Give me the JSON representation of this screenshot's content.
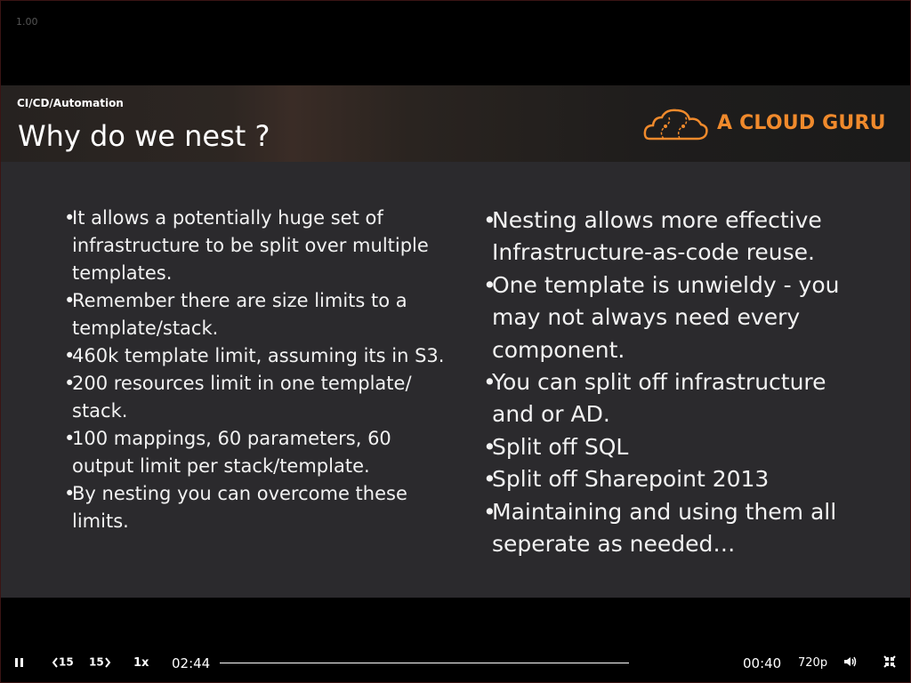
{
  "player": {
    "zoom_label": "1.00",
    "speed": "1x",
    "rewind_label": "15",
    "forward_label": "15",
    "current_time": "02:44",
    "remaining_time": "00:40",
    "quality": "720p",
    "icons": [
      "pause-icon",
      "rewind-15-icon",
      "forward-15-icon",
      "volume-icon",
      "exit-fullscreen-icon"
    ]
  },
  "slide": {
    "category": "CI/CD/Automation",
    "title": "Why do we nest ?",
    "logo_text": "A CLOUD GURU",
    "brand_color": "#f08a2c",
    "left_bullets": [
      "It allows a potentially huge set of infrastructure to be split over multiple templates.",
      "Remember there are size limits to a template/stack.",
      "460k template limit, assuming its in S3.",
      "200 resources limit in one template/ stack.",
      "100 mappings, 60 parameters,  60 output limit per stack/template.",
      "By nesting you can overcome these limits."
    ],
    "right_bullets": [
      "Nesting allows more effective Infrastructure-as-code reuse.",
      "One template is unwieldy - you may not always need every component.",
      "You can split off infrastructure and or AD.",
      "Split off SQL",
      "Split off Sharepoint 2013",
      "Maintaining and using them all seperate as needed…"
    ]
  }
}
